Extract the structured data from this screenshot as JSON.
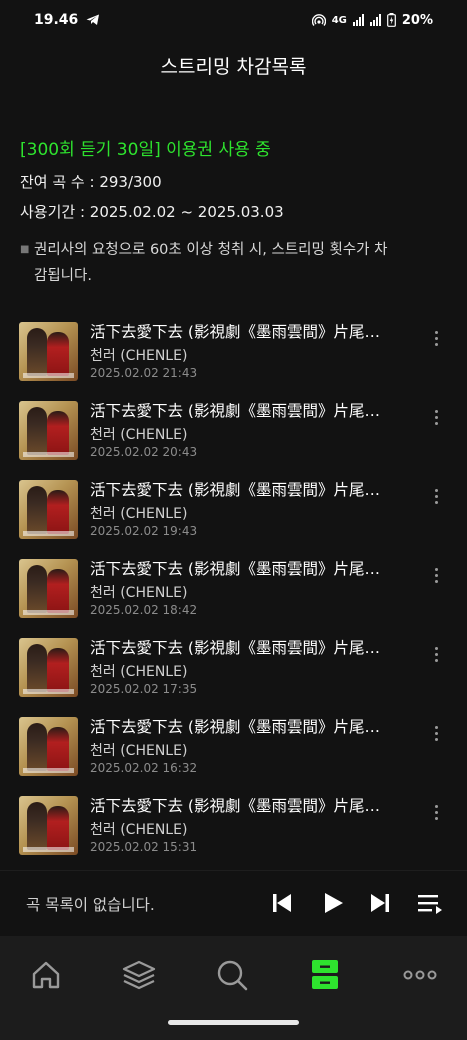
{
  "status": {
    "time": "19.46",
    "network": "4G",
    "battery": "20%"
  },
  "header": {
    "title": "스트리밍 차감목록"
  },
  "info": {
    "pass": "[300회 듣기 30일] 이용권 사용 중",
    "remaining": "잔여 곡 수 : 293/300",
    "period": "사용기간 : 2025.02.02 ~ 2025.03.03",
    "notice_line1": "권리사의 요청으로 60초 이상 청취 시, 스트리밍 횟수가 차",
    "notice_line2": "감됩니다."
  },
  "tracks": [
    {
      "title": "活下去愛下去 (影視劇《墨雨雲間》片尾…",
      "artist": "천러 (CHENLE)",
      "date": "2025.02.02 21:43"
    },
    {
      "title": "活下去愛下去 (影視劇《墨雨雲間》片尾…",
      "artist": "천러 (CHENLE)",
      "date": "2025.02.02 20:43"
    },
    {
      "title": "活下去愛下去 (影視劇《墨雨雲間》片尾…",
      "artist": "천러 (CHENLE)",
      "date": "2025.02.02 19:43"
    },
    {
      "title": "活下去愛下去 (影視劇《墨雨雲間》片尾…",
      "artist": "천러 (CHENLE)",
      "date": "2025.02.02 18:42"
    },
    {
      "title": "活下去愛下去 (影視劇《墨雨雲間》片尾…",
      "artist": "천러 (CHENLE)",
      "date": "2025.02.02 17:35"
    },
    {
      "title": "活下去愛下去 (影視劇《墨雨雲間》片尾…",
      "artist": "천러 (CHENLE)",
      "date": "2025.02.02 16:32"
    },
    {
      "title": "活下去愛下去 (影視劇《墨雨雲間》片尾…",
      "artist": "천러 (CHENLE)",
      "date": "2025.02.02 15:31"
    }
  ],
  "player": {
    "empty_message": "곡 목록이 없습니다."
  },
  "nav": {
    "items": [
      "home-icon",
      "library-icon",
      "search-icon",
      "storage-icon",
      "more-icon"
    ],
    "active": "storage-icon"
  },
  "colors": {
    "accent": "#2ee32e",
    "background": "#121212",
    "nav_background": "#1c1c1c"
  }
}
